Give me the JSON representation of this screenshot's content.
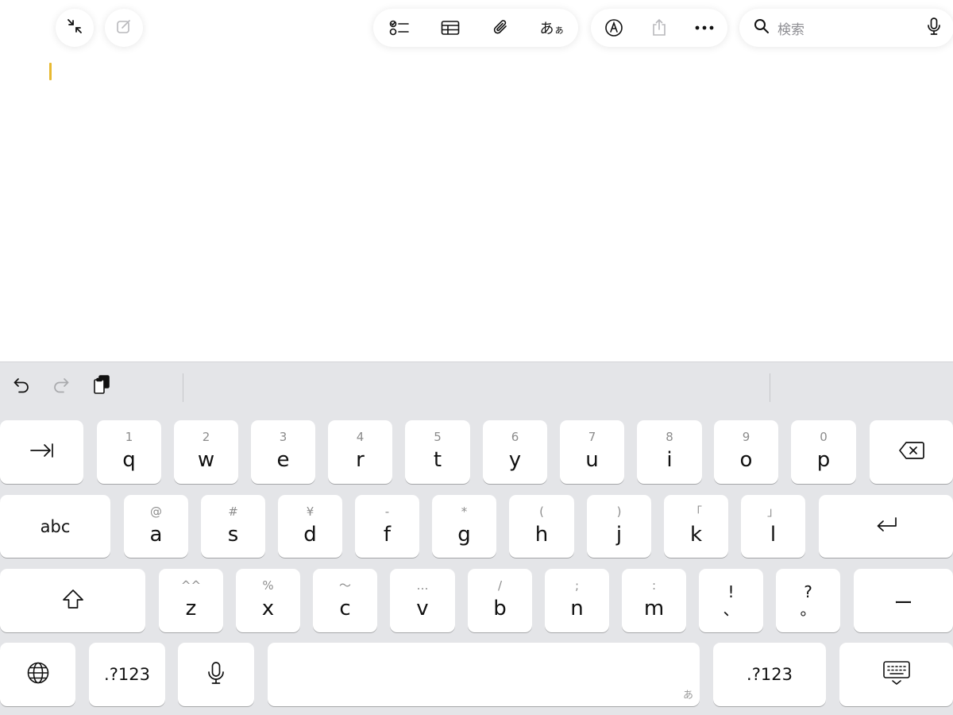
{
  "toolbar": {
    "left_buttons": [
      {
        "name": "collapse-icon"
      },
      {
        "name": "compose-icon"
      }
    ],
    "format_group": [
      {
        "name": "checklist-icon"
      },
      {
        "name": "table-icon"
      },
      {
        "name": "paperclip-icon"
      },
      {
        "name": "text-format-button",
        "label": "あ",
        "label_small": "ぁ"
      }
    ],
    "action_group": [
      {
        "name": "markup-icon"
      },
      {
        "name": "share-icon"
      },
      {
        "name": "more-icon"
      }
    ],
    "search": {
      "placeholder": "検索",
      "icon": "search-icon",
      "mic_icon": "mic-icon"
    }
  },
  "editor": {
    "caret_color": "#e8b931"
  },
  "keyboard_toolbar": [
    {
      "name": "undo-icon"
    },
    {
      "name": "redo-icon"
    },
    {
      "name": "paste-icon"
    }
  ],
  "keyboard": {
    "row1": [
      {
        "key": "tab",
        "icon": "tab-icon"
      },
      {
        "key": "q",
        "sub": "1"
      },
      {
        "key": "w",
        "sub": "2"
      },
      {
        "key": "e",
        "sub": "3"
      },
      {
        "key": "r",
        "sub": "4"
      },
      {
        "key": "t",
        "sub": "5"
      },
      {
        "key": "y",
        "sub": "6"
      },
      {
        "key": "u",
        "sub": "7"
      },
      {
        "key": "i",
        "sub": "8"
      },
      {
        "key": "o",
        "sub": "9"
      },
      {
        "key": "p",
        "sub": "0"
      },
      {
        "key": "delete",
        "icon": "delete-icon"
      }
    ],
    "row2": [
      {
        "key": "abc"
      },
      {
        "key": "a",
        "sub": "@"
      },
      {
        "key": "s",
        "sub": "#"
      },
      {
        "key": "d",
        "sub": "¥"
      },
      {
        "key": "f",
        "sub": "-"
      },
      {
        "key": "g",
        "sub": "*"
      },
      {
        "key": "h",
        "sub": "("
      },
      {
        "key": "j",
        "sub": ")"
      },
      {
        "key": "k",
        "sub": "「"
      },
      {
        "key": "l",
        "sub": "」"
      },
      {
        "key": "return",
        "icon": "return-icon"
      }
    ],
    "row3": [
      {
        "key": "shift",
        "icon": "shift-icon"
      },
      {
        "key": "z",
        "sub": "^^"
      },
      {
        "key": "x",
        "sub": "%"
      },
      {
        "key": "c",
        "sub": "〜"
      },
      {
        "key": "v",
        "sub": "…"
      },
      {
        "key": "b",
        "sub": "/"
      },
      {
        "key": "n",
        "sub": ";"
      },
      {
        "key": "m",
        "sub": ":"
      },
      {
        "key": "!",
        "bottom": "、"
      },
      {
        "key": "?",
        "bottom": "。"
      },
      {
        "key": "ー"
      }
    ],
    "row4": [
      {
        "key": "globe",
        "icon": "globe-icon"
      },
      {
        "key": ".?123"
      },
      {
        "key": "dictation",
        "icon": "mic-icon"
      },
      {
        "key": "space",
        "hint": "あ"
      },
      {
        "key": ".?123"
      },
      {
        "key": "hide-keyboard",
        "icon": "keyboard-hide-icon"
      }
    ]
  }
}
